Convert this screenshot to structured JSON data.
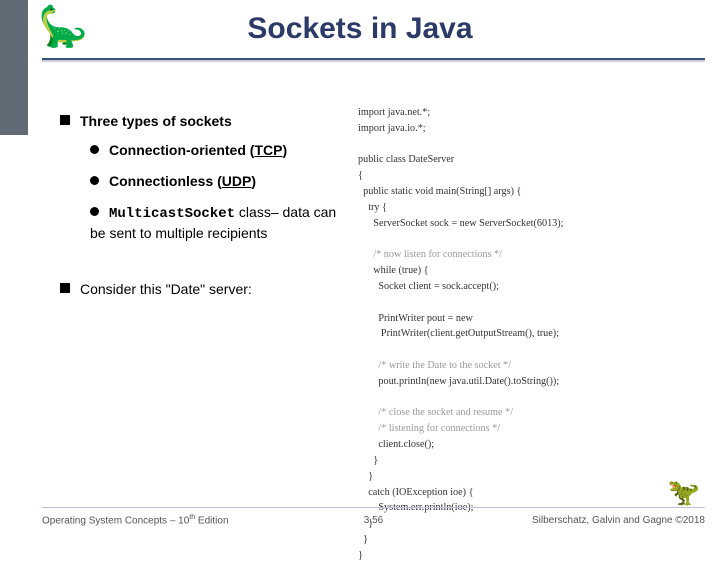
{
  "title": "Sockets in Java",
  "bullets": {
    "b1": "Three types of sockets",
    "b1a_prefix": "Connection-oriented (",
    "b1a_link": "TCP",
    "b1a_suffix": ")",
    "b1b_prefix": "Connectionless (",
    "b1b_link": "UDP",
    "b1b_suffix": ")",
    "b1c_code": "MulticastSocket",
    "b1c_rest": " class– data can be sent to multiple recipients",
    "b2": "Consider this \"Date\" server:"
  },
  "code": {
    "l01": "import java.net.*;",
    "l02": "import java.io.*;",
    "l03": "",
    "l04": "public class DateServer",
    "l05": "{",
    "l06": "  public static void main(String[] args) {",
    "l07": "    try {",
    "l08": "      ServerSocket sock = new ServerSocket(6013);",
    "l09": "",
    "l10": "      /* now listen for connections */",
    "l11": "      while (true) {",
    "l12": "        Socket client = sock.accept();",
    "l13": "",
    "l14": "        PrintWriter pout = new",
    "l15": "         PrintWriter(client.getOutputStream(), true);",
    "l16": "",
    "l17": "        /* write the Date to the socket */",
    "l18": "        pout.println(new java.util.Date().toString());",
    "l19": "",
    "l20": "        /* close the socket and resume */",
    "l21": "        /* listening for connections */",
    "l22": "        client.close();",
    "l23": "      }",
    "l24": "    }",
    "l25": "    catch (IOException ioe) {",
    "l26": "        System.err.println(ioe);",
    "l27": "    }",
    "l28": "  }",
    "l29": "}"
  },
  "footer": {
    "left_a": "Operating System Concepts – 10",
    "left_sup": "th",
    "left_b": " Edition",
    "mid": "3.56",
    "right": "Silberschatz, Galvin and Gagne ©2018"
  }
}
